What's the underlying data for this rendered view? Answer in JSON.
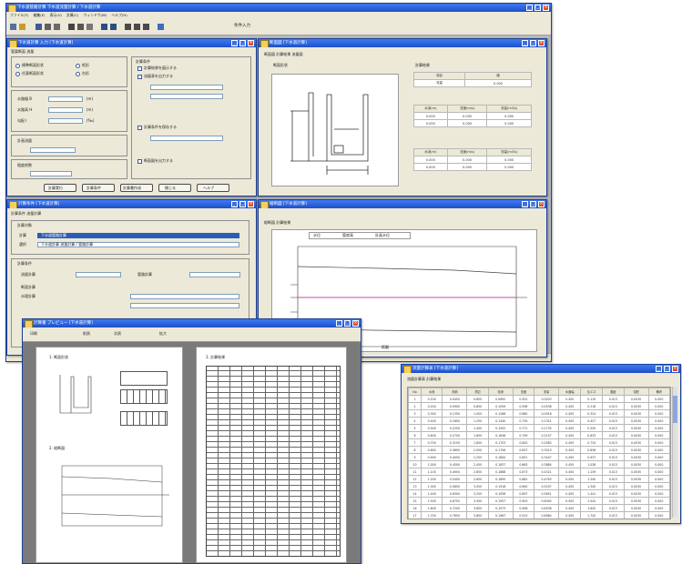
{
  "main_window": {
    "title": "下水道管路計算 下水道流量計算 / 下水道計算",
    "menu": [
      "ファイル(F)",
      "編集(E)",
      "表示(V)",
      "計算(C)",
      "ウィンドウ(W)",
      "ヘルプ(H)"
    ],
    "toolbar_label": "条件入力"
  },
  "input_window": {
    "title": "下水道計算 入力 [下水道計算]",
    "tab": "管渠断面 流量",
    "radio_options": [
      "標準断面形状",
      "任意断面形状"
    ],
    "right_radio_options": [
      "矩形",
      "台形"
    ],
    "field_labels": [
      "水路幅 B",
      "水路高 H",
      "勾配 I"
    ],
    "field_units": [
      "(m)",
      "(m)",
      "(‰)"
    ],
    "section_label_flow": "計画流量",
    "section_label_coef": "粗度係数",
    "options_label": "計算条件",
    "checkbox_labels": [
      "計算結果を図示する",
      "流量表を出力する",
      "計算条件を保存する",
      "断面図を出力する"
    ],
    "buttons": [
      "計算実行",
      "計算条件",
      "計算書作成",
      "閉じる",
      "ヘルプ"
    ]
  },
  "section_window": {
    "title": "断面図 [下水道計算]",
    "tab": "断面図 計算結果 流量図",
    "diagram_label": "断面形状",
    "dims_label": "計算結果",
    "table1": {
      "headers": [
        "項目",
        "値"
      ],
      "rows": [
        [
          "流量",
          "0.000"
        ]
      ]
    },
    "table2": {
      "headers": [
        "水深(m)",
        "流速(m/s)",
        "流量(m3/s)"
      ],
      "rows": [
        [
          "0.000",
          "0.000",
          "0.000"
        ],
        [
          "0.000",
          "0.000",
          "0.000"
        ]
      ]
    },
    "table3": {
      "headers": [
        "水深(m)",
        "流速(m/s)",
        "流量(m3/s)"
      ],
      "rows": [
        [
          "0.000",
          "0.000",
          "0.000"
        ],
        [
          "0.000",
          "0.000",
          "0.000"
        ]
      ]
    }
  },
  "settings_window": {
    "title": "計算条件 [下水道計算]",
    "tab": "計算条件 流量計算",
    "group1_label": "計算対象",
    "row1_label": "計算",
    "row1_value": "下水道管路計算",
    "row2_label": "選択",
    "row2_value": "下水道計算 流量計算 / 管路計算",
    "group2_label": "計算条件",
    "options": [
      "流量計算",
      "管路計算",
      "断面計算",
      "水理計算"
    ]
  },
  "profile_window": {
    "title": "縦断図 [下水道計算]",
    "tab": "縦断図 計算結果",
    "legend": [
      "水位",
      "管底高",
      "計画水位"
    ],
    "bottom_label": "距離"
  },
  "report_window": {
    "title": "計算書 プレビュー [下水道計算]",
    "toolbar": [
      "印刷",
      "前頁",
      "次頁",
      "拡大"
    ],
    "page_left_heading1": "1. 断面形状",
    "page_left_heading2": "2. 縦断図",
    "page_right_heading": "3. 計算結果"
  },
  "table_window": {
    "title": "流量計算表 [下水道計算]",
    "tab": "流量計算表 計算結果",
    "headers": [
      "No",
      "水深",
      "流積",
      "潤辺",
      "径深",
      "流速",
      "流量",
      "水面幅",
      "比エネ",
      "粗度",
      "勾配",
      "備考"
    ],
    "rows": [
      [
        "1",
        "0.100",
        "0.0450",
        "0.650",
        "0.0692",
        "0.452",
        "0.0203",
        "0.450",
        "0.110",
        "0.013",
        "0.0030",
        "0.000"
      ],
      [
        "2",
        "0.200",
        "0.0900",
        "0.850",
        "0.1059",
        "0.598",
        "0.0538",
        "0.450",
        "0.218",
        "0.013",
        "0.0030",
        "0.000"
      ],
      [
        "3",
        "0.300",
        "0.1350",
        "1.050",
        "0.1286",
        "0.680",
        "0.0918",
        "0.450",
        "0.324",
        "0.013",
        "0.0030",
        "0.000"
      ],
      [
        "4",
        "0.400",
        "0.1800",
        "1.250",
        "0.1440",
        "0.734",
        "0.1321",
        "0.450",
        "0.427",
        "0.013",
        "0.0030",
        "0.000"
      ],
      [
        "5",
        "0.500",
        "0.2250",
        "1.450",
        "0.1552",
        "0.771",
        "0.1735",
        "0.450",
        "0.530",
        "0.013",
        "0.0030",
        "0.000"
      ],
      [
        "6",
        "0.600",
        "0.2700",
        "1.650",
        "0.1636",
        "0.799",
        "0.2157",
        "0.450",
        "0.633",
        "0.013",
        "0.0030",
        "0.000"
      ],
      [
        "7",
        "0.700",
        "0.3150",
        "1.850",
        "0.1703",
        "0.820",
        "0.2583",
        "0.450",
        "0.734",
        "0.013",
        "0.0030",
        "0.000"
      ],
      [
        "8",
        "0.800",
        "0.3600",
        "2.050",
        "0.1756",
        "0.837",
        "0.3013",
        "0.450",
        "0.836",
        "0.013",
        "0.0030",
        "0.000"
      ],
      [
        "9",
        "0.900",
        "0.4050",
        "2.250",
        "0.1800",
        "0.851",
        "0.3447",
        "0.450",
        "0.937",
        "0.013",
        "0.0030",
        "0.000"
      ],
      [
        "10",
        "1.000",
        "0.4500",
        "2.450",
        "0.1837",
        "0.863",
        "0.3884",
        "0.450",
        "1.038",
        "0.013",
        "0.0030",
        "0.000"
      ],
      [
        "11",
        "1.100",
        "0.4950",
        "2.650",
        "0.1868",
        "0.873",
        "0.4321",
        "0.450",
        "1.139",
        "0.013",
        "0.0030",
        "0.000"
      ],
      [
        "12",
        "1.200",
        "0.5400",
        "2.850",
        "0.1895",
        "0.882",
        "0.4763",
        "0.450",
        "1.240",
        "0.013",
        "0.0030",
        "0.000"
      ],
      [
        "13",
        "1.300",
        "0.5850",
        "3.050",
        "0.1918",
        "0.890",
        "0.5207",
        "0.450",
        "1.340",
        "0.013",
        "0.0030",
        "0.000"
      ],
      [
        "14",
        "1.400",
        "0.6300",
        "3.250",
        "0.1938",
        "0.897",
        "0.5651",
        "0.450",
        "1.441",
        "0.013",
        "0.0030",
        "0.000"
      ],
      [
        "15",
        "1.500",
        "0.6750",
        "3.450",
        "0.1957",
        "0.903",
        "0.6095",
        "0.450",
        "1.542",
        "0.013",
        "0.0030",
        "0.000"
      ],
      [
        "16",
        "1.600",
        "0.7200",
        "3.650",
        "0.1973",
        "0.908",
        "0.6538",
        "0.450",
        "1.642",
        "0.013",
        "0.0030",
        "0.000"
      ],
      [
        "17",
        "1.700",
        "0.7650",
        "3.850",
        "0.1987",
        "0.913",
        "0.6984",
        "0.450",
        "1.742",
        "0.013",
        "0.0030",
        "0.000"
      ],
      [
        "18",
        "1.800",
        "0.8100",
        "4.050",
        "0.2000",
        "0.917",
        "0.7428",
        "0.450",
        "1.843",
        "0.013",
        "0.0030",
        "0.000"
      ]
    ]
  }
}
